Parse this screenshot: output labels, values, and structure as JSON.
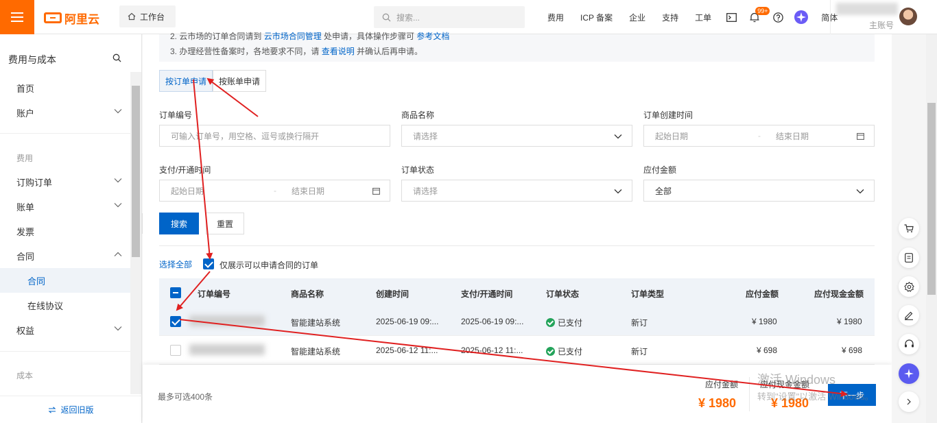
{
  "topbar": {
    "logo_text": "阿里云",
    "workbench": "工作台",
    "search_placeholder": "搜索...",
    "nav": [
      "费用",
      "ICP 备案",
      "企业",
      "支持",
      "工单"
    ],
    "notification_badge": "99+",
    "language": "简体",
    "account_label": "主账号"
  },
  "sidebar": {
    "title": "费用与成本",
    "items": [
      {
        "label": "首页"
      },
      {
        "label": "账户"
      },
      {
        "label": "费用"
      },
      {
        "label": "订购订单"
      },
      {
        "label": "账单"
      },
      {
        "label": "发票"
      },
      {
        "label": "合同"
      },
      {
        "label": "合同"
      },
      {
        "label": "在线协议"
      },
      {
        "label": "权益"
      },
      {
        "label": "成本"
      }
    ],
    "back_old": "返回旧版"
  },
  "notice": {
    "line1_prefix": "2. 云市场的订单合同请到",
    "line1_link": "云市场合同管理",
    "line1_mid": "处申请，具体操作步骤可",
    "line1_link2": "参考文档",
    "line2_prefix": "3. 办理经营性备案时，各地要求不同，请",
    "line2_link": "查看说明",
    "line2_suffix": "并确认后再申请。"
  },
  "tabs": [
    "按订单申请",
    "按账单申请"
  ],
  "filters": {
    "order_no_label": "订单编号",
    "order_no_placeholder": "可输入订单号，用空格、逗号或换行隔开",
    "product_label": "商品名称",
    "product_placeholder": "请选择",
    "create_time_label": "订单创建时间",
    "start_date": "起始日期",
    "end_date": "结束日期",
    "pay_time_label": "支付/开通时间",
    "status_label": "订单状态",
    "status_placeholder": "请选择",
    "amount_label": "应付金额",
    "amount_value": "全部"
  },
  "buttons": {
    "search": "搜索",
    "reset": "重置"
  },
  "selection": {
    "select_all": "选择全部",
    "only_contract": "仅展示可以申请合同的订单"
  },
  "table": {
    "columns": [
      "订单编号",
      "商品名称",
      "创建时间",
      "支付/开通时间",
      "订单状态",
      "订单类型",
      "应付金额",
      "应付现金金额"
    ],
    "rows": [
      {
        "checked": true,
        "product": "智能建站系统",
        "created": "2025-06-19 09:...",
        "paid": "2025-06-19 09:...",
        "status": "已支付",
        "type": "新订",
        "amount": "¥ 1980",
        "cash": "¥ 1980"
      },
      {
        "checked": false,
        "product": "智能建站系统",
        "created": "2025-06-12 11:...",
        "paid": "2025-06-12 11:...",
        "status": "已支付",
        "type": "新订",
        "amount": "¥ 698",
        "cash": "¥ 698"
      }
    ]
  },
  "footer": {
    "max_note": "最多可选400条",
    "pay_label": "应付金额",
    "pay_amount": "¥ 1980",
    "cash_label": "应付现金金额",
    "cash_amount": "¥ 1980",
    "next": "下一步"
  },
  "watermark": {
    "line1": "激活 Windows",
    "line2": "转到\"设置\"以激活 Windows。"
  },
  "colors": {
    "brand": "#ff6a00",
    "primary": "#0064c8",
    "annotation": "#e02020"
  }
}
